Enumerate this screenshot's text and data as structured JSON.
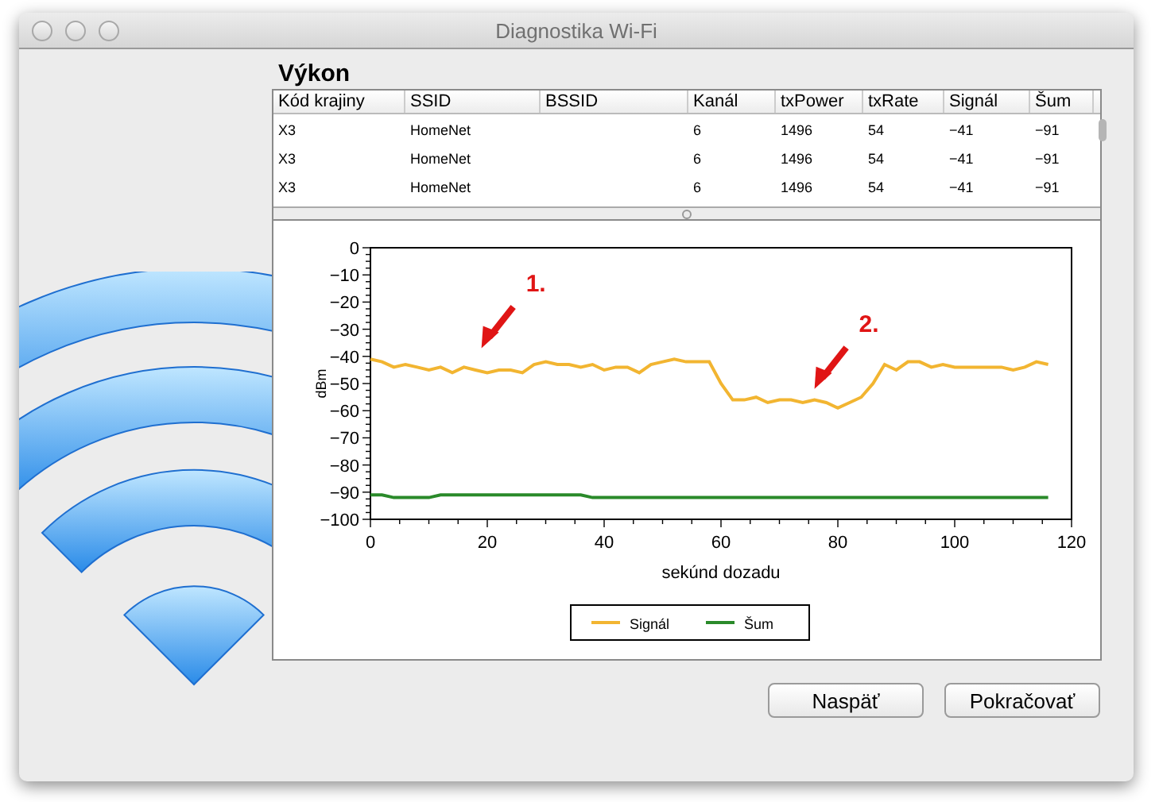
{
  "window": {
    "title": "Diagnostika Wi-Fi"
  },
  "section_title": "Výkon",
  "table": {
    "columns": [
      "Kód krajiny",
      "SSID",
      "BSSID",
      "Kanál",
      "txPower",
      "txRate",
      "Signál",
      "Šum"
    ],
    "rows": [
      {
        "cells": [
          "X3",
          "HomeNet",
          null,
          "6",
          "1496",
          "54",
          "−41",
          "−91"
        ]
      },
      {
        "cells": [
          "X3",
          "HomeNet",
          null,
          "6",
          "1496",
          "54",
          "−41",
          "−91"
        ]
      },
      {
        "cells": [
          "X3",
          "HomeNet",
          null,
          "6",
          "1496",
          "54",
          "−41",
          "−91"
        ]
      }
    ]
  },
  "chart": {
    "chart_data": {
      "type": "line",
      "xlabel": "sekúnd dozadu",
      "ylabel": "dBm",
      "x": [
        0,
        2,
        4,
        6,
        8,
        10,
        12,
        14,
        16,
        18,
        20,
        22,
        24,
        26,
        28,
        30,
        32,
        34,
        36,
        38,
        40,
        42,
        44,
        46,
        48,
        50,
        52,
        54,
        56,
        58,
        60,
        62,
        64,
        66,
        68,
        70,
        72,
        74,
        76,
        78,
        80,
        82,
        84,
        86,
        88,
        90,
        92,
        94,
        96,
        98,
        100,
        102,
        104,
        106,
        108,
        110,
        112,
        114,
        116
      ],
      "series": [
        {
          "name": "Signál",
          "color": "#f2b531",
          "values": [
            -41,
            -42,
            -44,
            -43,
            -44,
            -45,
            -44,
            -46,
            -44,
            -45,
            -46,
            -45,
            -45,
            -46,
            -43,
            -42,
            -43,
            -43,
            -44,
            -43,
            -45,
            -44,
            -44,
            -46,
            -43,
            -42,
            -41,
            -42,
            -42,
            -42,
            -50,
            -56,
            -56,
            -55,
            -57,
            -56,
            -56,
            -57,
            -56,
            -57,
            -59,
            -57,
            -55,
            -50,
            -43,
            -45,
            -42,
            -42,
            -44,
            -43,
            -44,
            -44,
            -44,
            -44,
            -44,
            -45,
            -44,
            -42,
            -43
          ]
        },
        {
          "name": "Šum",
          "color": "#2a8a2a",
          "values": [
            -91,
            -91,
            -92,
            -92,
            -92,
            -92,
            -91,
            -91,
            -91,
            -91,
            -91,
            -91,
            -91,
            -91,
            -91,
            -91,
            -91,
            -91,
            -91,
            -92,
            -92,
            -92,
            -92,
            -92,
            -92,
            -92,
            -92,
            -92,
            -92,
            -92,
            -92,
            -92,
            -92,
            -92,
            -92,
            -92,
            -92,
            -92,
            -92,
            -92,
            -92,
            -92,
            -92,
            -92,
            -92,
            -92,
            -92,
            -92,
            -92,
            -92,
            -92,
            -92,
            -92,
            -92,
            -92,
            -92,
            -92,
            -92,
            -92
          ]
        }
      ],
      "xlim": [
        0,
        120
      ],
      "ylim": [
        -100,
        0
      ],
      "xticks": [
        0,
        20,
        40,
        60,
        80,
        100,
        120
      ],
      "yticks": [
        0,
        -10,
        -20,
        -30,
        -40,
        -50,
        -60,
        -70,
        -80,
        -90,
        -100
      ],
      "legend": "bottom",
      "annotations": [
        {
          "text": "1."
        },
        {
          "text": "2."
        }
      ]
    }
  },
  "buttons": [
    "Naspäť",
    "Pokračovať"
  ]
}
